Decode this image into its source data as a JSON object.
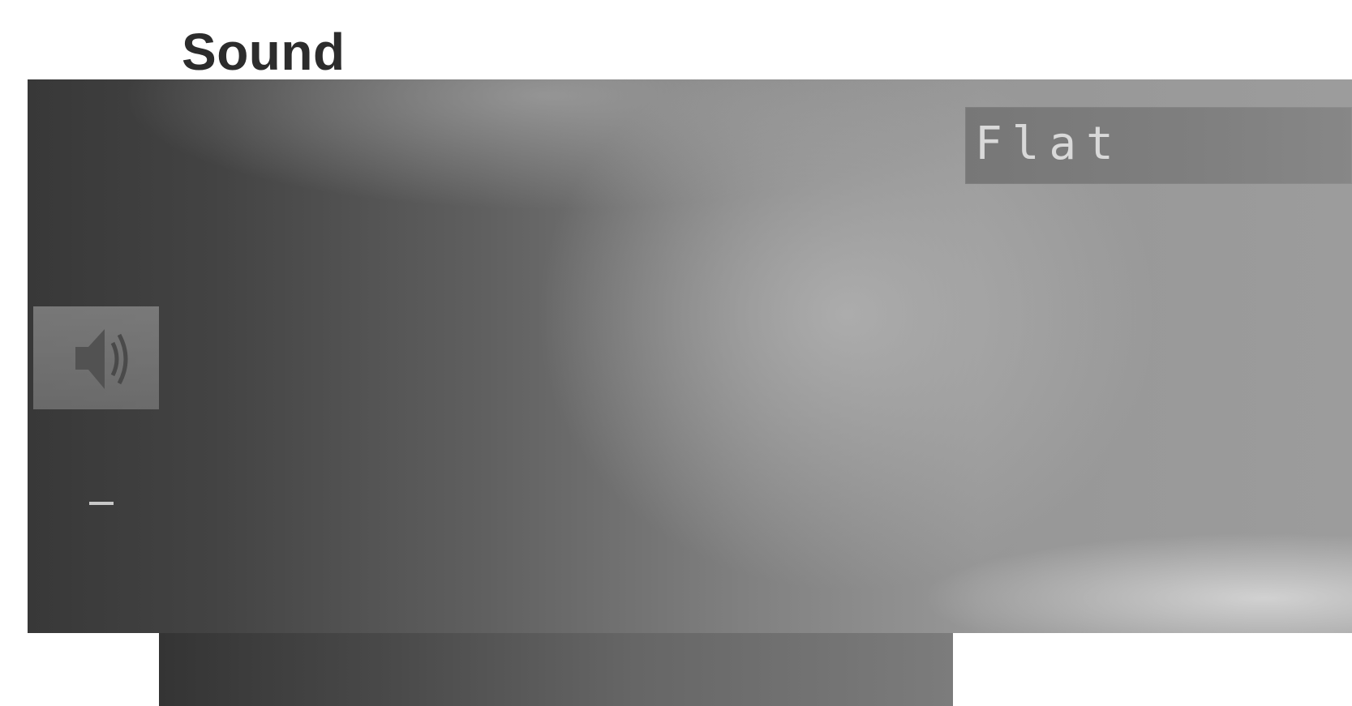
{
  "page": {
    "title": "Sound"
  },
  "screen": {
    "preset": {
      "value": "Flat"
    },
    "icon": "speaker-icon",
    "level_indicator": "–"
  },
  "colors": {
    "title": "#2c2c2c",
    "screen_dark": "#383838",
    "screen_light": "#9c9c9c",
    "preset_bar": "#7f7f7f",
    "preset_text": "#d9d9d9"
  }
}
